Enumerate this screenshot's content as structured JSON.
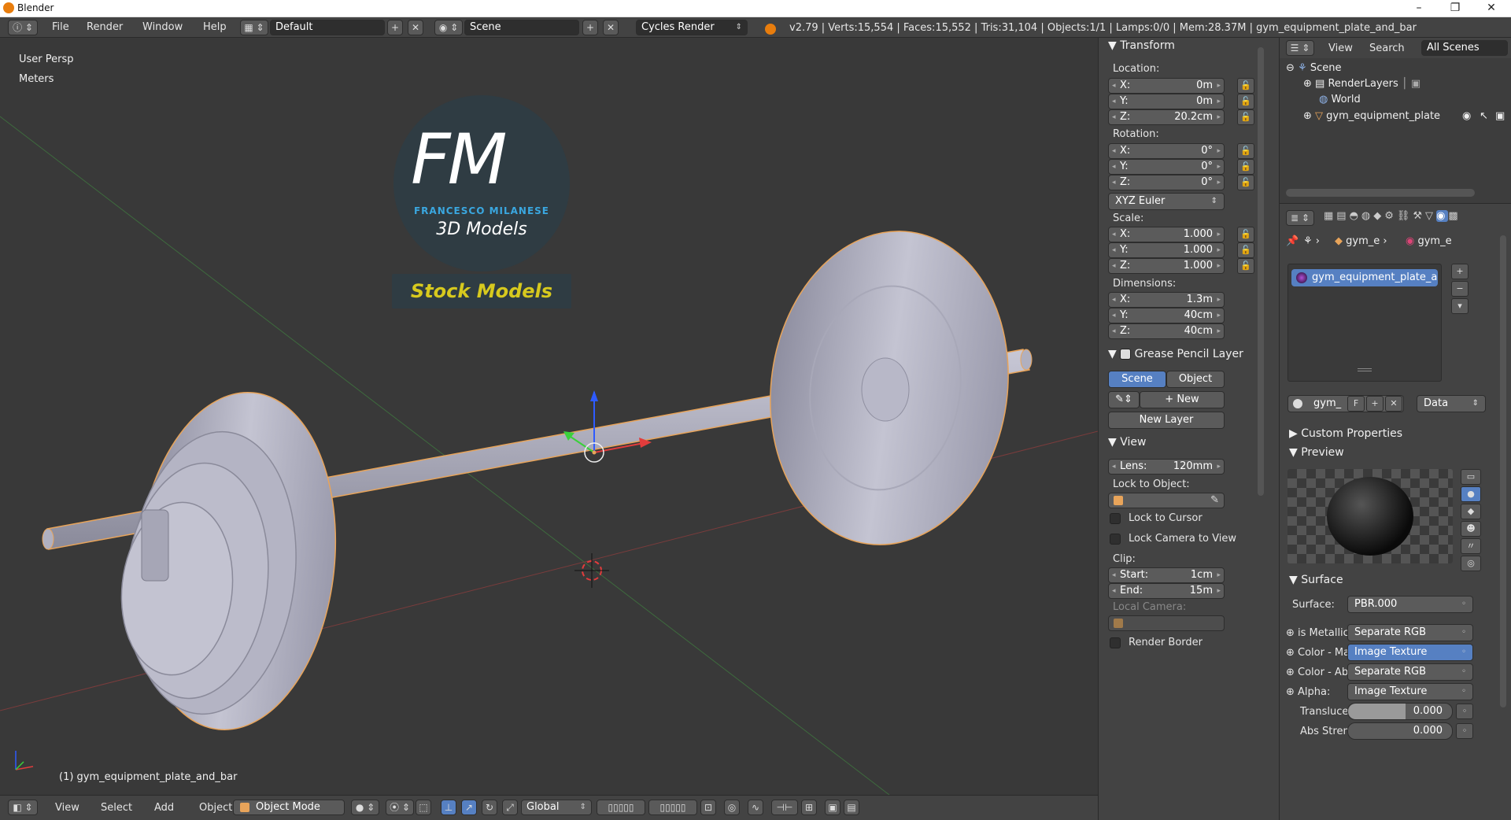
{
  "window": {
    "title": "Blender",
    "minimize": "–",
    "maximize": "❐",
    "close": "✕"
  },
  "menubar": {
    "menus": [
      "File",
      "Render",
      "Window",
      "Help"
    ],
    "screen_layout": "Default",
    "scene": "Scene",
    "render_engine": "Cycles Render",
    "stats": "v2.79 | Verts:15,554 | Faces:15,552 | Tris:31,104 | Objects:1/1 | Lamps:0/0 | Mem:28.37M | gym_equipment_plate_and_bar"
  },
  "viewport": {
    "view_name": "User Persp",
    "units": "Meters",
    "object_label": "(1) gym_equipment_plate_and_bar",
    "logo": {
      "initials": "FM",
      "author": "FRANCESCO MILANESE",
      "tagline": "3D Models",
      "banner": "Stock Models"
    }
  },
  "viewport_footer": {
    "menus": [
      "View",
      "Select",
      "Add",
      "Object"
    ],
    "mode": "Object Mode",
    "orientation": "Global"
  },
  "transform": {
    "title": "Transform",
    "location_label": "Location:",
    "location": [
      {
        "axis": "X:",
        "value": "0m"
      },
      {
        "axis": "Y:",
        "value": "0m"
      },
      {
        "axis": "Z:",
        "value": "20.2cm"
      }
    ],
    "rotation_label": "Rotation:",
    "rotation": [
      {
        "axis": "X:",
        "value": "0°"
      },
      {
        "axis": "Y:",
        "value": "0°"
      },
      {
        "axis": "Z:",
        "value": "0°"
      }
    ],
    "rotation_mode": "XYZ Euler",
    "scale_label": "Scale:",
    "scale": [
      {
        "axis": "X:",
        "value": "1.000"
      },
      {
        "axis": "Y:",
        "value": "1.000"
      },
      {
        "axis": "Z:",
        "value": "1.000"
      }
    ],
    "dimensions_label": "Dimensions:",
    "dimensions": [
      {
        "axis": "X:",
        "value": "1.3m"
      },
      {
        "axis": "Y:",
        "value": "40cm"
      },
      {
        "axis": "Z:",
        "value": "40cm"
      }
    ]
  },
  "grease_pencil": {
    "title": "Grease Pencil Layer",
    "tab_scene": "Scene",
    "tab_object": "Object",
    "new_label": "New",
    "new_layer_label": "New Layer"
  },
  "view_panel": {
    "title": "View",
    "lens_label": "Lens:",
    "lens_value": "120mm",
    "lock_object_label": "Lock to Object:",
    "lock_cursor": "Lock to Cursor",
    "lock_camera": "Lock Camera to View",
    "clip_label": "Clip:",
    "clip_start_label": "Start:",
    "clip_start": "1cm",
    "clip_end_label": "End:",
    "clip_end": "15m",
    "local_camera": "Local Camera:",
    "render_border": "Render Border"
  },
  "outliner": {
    "view_menu": "View",
    "search_menu": "Search",
    "filter": "All Scenes",
    "items": [
      "Scene",
      "RenderLayers",
      "World",
      "gym_equipment_plate"
    ]
  },
  "properties": {
    "crumb_object": "gym_e",
    "crumb_material": "gym_e",
    "material_slot": "gym_equipment_plate_a...",
    "material_name": "gym_",
    "fake_user": "F",
    "link": "Data",
    "custom_properties": "Custom Properties",
    "preview": "Preview",
    "surface_title": "Surface",
    "surface_label": "Surface:",
    "surface_value": "PBR.000",
    "inputs": [
      {
        "label": "is Metallic",
        "value": "Separate RGB",
        "active": false
      },
      {
        "label": "Color - Ma",
        "value": "Image Texture",
        "active": true
      },
      {
        "label": "Color - Ab",
        "value": "Separate RGB",
        "active": false
      },
      {
        "label": "Alpha:",
        "value": "Image Texture",
        "active": false
      }
    ],
    "translucency_label": "Transluce",
    "translucency_value": "0.000",
    "abs_strength_label": "Abs Stren",
    "abs_strength_value": "0.000"
  },
  "colors": {
    "selection_blue": "#5680c2",
    "object_outline": "#e8a45a",
    "background": "#393939",
    "banner_text": "#d7c91e",
    "logo_blue": "#3aa7e0"
  }
}
